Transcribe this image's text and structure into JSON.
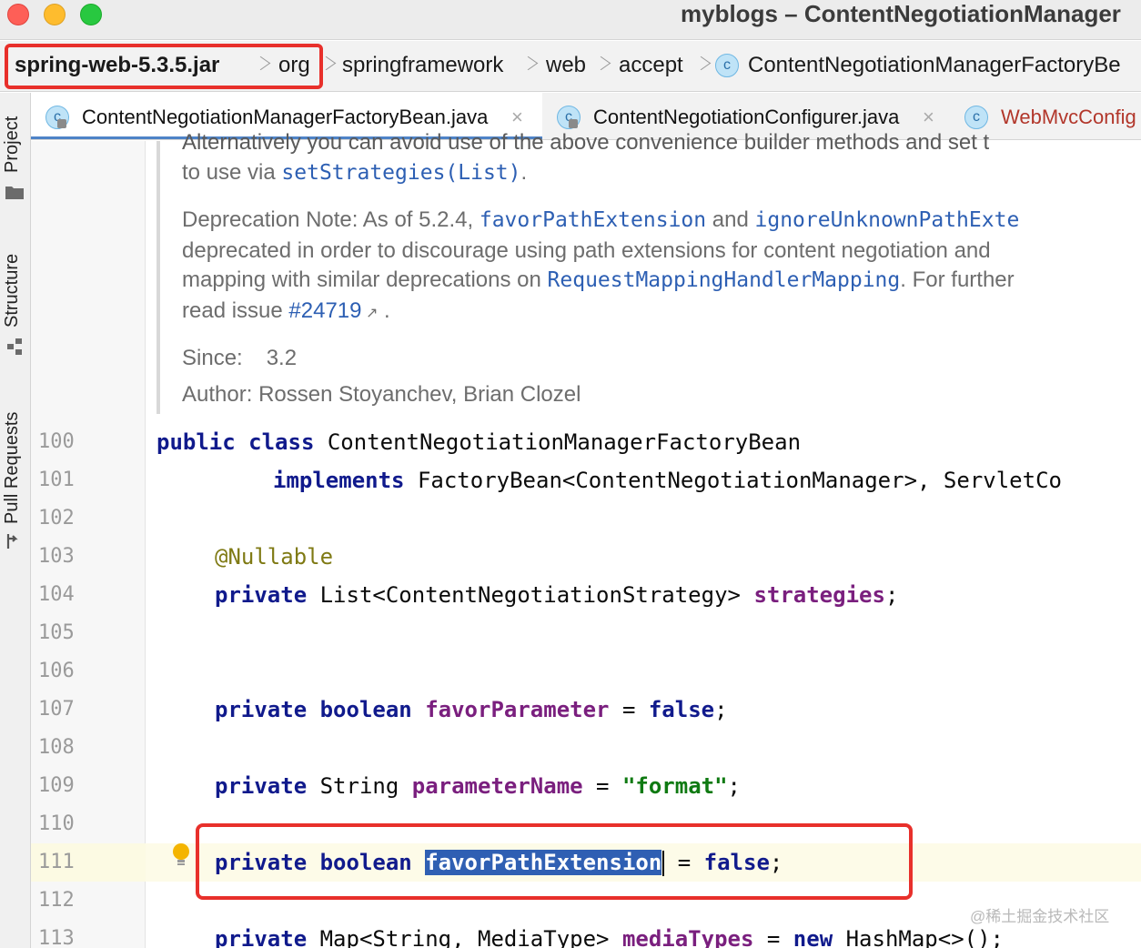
{
  "window": {
    "title": "myblogs – ContentNegotiationManager"
  },
  "breadcrumb": {
    "items": [
      "spring-web-5.3.5.jar",
      "org",
      "springframework",
      "web",
      "accept",
      "ContentNegotiationManagerFactoryBe"
    ]
  },
  "toolstrip": {
    "project": "Project",
    "structure": "Structure",
    "pull_requests": "Pull Requests"
  },
  "tabs": [
    {
      "label": "ContentNegotiationManagerFactoryBean.java",
      "close": "×",
      "active": true
    },
    {
      "label": "ContentNegotiationConfigurer.java",
      "close": "×",
      "active": false
    },
    {
      "label": "WebMvcConfig",
      "active": false
    }
  ],
  "doc": {
    "clipped_line": "Alternatively you can avoid use of the above convenience builder methods and set t",
    "line1_prefix": "to use via ",
    "line1_code": "setStrategies(List)",
    "line1_suffix": ".",
    "note_prefix": "Deprecation Note: As of 5.2.4, ",
    "note_code1": "favorPathExtension",
    "note_and": " and ",
    "note_code2": "ignoreUnknownPathExte",
    "note_line2": "deprecated in order to discourage using path extensions for content negotiation and",
    "note_line3_prefix": "mapping with similar deprecations on ",
    "note_line3_code": "RequestMappingHandlerMapping",
    "note_line3_suffix": ". For further",
    "note_line4_prefix": "read issue ",
    "note_line4_link": "#24719",
    "note_line4_suffix": " .",
    "since_label": "Since:",
    "since_value": "3.2",
    "author_label": "Author:",
    "author_value": "Rossen Stoyanchev, Brian Clozel"
  },
  "code": {
    "line_numbers": [
      "100",
      "101",
      "102",
      "103",
      "104",
      "105",
      "106",
      "107",
      "108",
      "109",
      "110",
      "111",
      "112",
      "113"
    ],
    "l100_kw": "public class",
    "l100_rest": " ContentNegotiationManagerFactoryBean",
    "l101_kw": "implements",
    "l101_rest": " FactoryBean<ContentNegotiationManager>, ServletCo",
    "l103_ann": "@Nullable",
    "l104_kw": "private",
    "l104_type": " List<ContentNegotiationStrategy> ",
    "l104_field": "strategies",
    "l104_end": ";",
    "l107_kw": "private boolean",
    "l107_field": "favorParameter",
    "l107_eq": " = ",
    "l107_val": "false",
    "l107_end": ";",
    "l109_kw": "private",
    "l109_type": " String ",
    "l109_field": "parameterName",
    "l109_eq": " = ",
    "l109_str": "\"format\"",
    "l109_end": ";",
    "l111_kw": "private boolean",
    "l111_field": "favorPathExtension",
    "l111_eq": " = ",
    "l111_val": "false",
    "l111_end": ";",
    "l113_kw": "private",
    "l113_type": " Map<String, MediaType> ",
    "l113_field": "mediaTypes",
    "l113_eq": " = ",
    "l113_new": "new",
    "l113_rest": " HashMap<>();"
  },
  "watermark": "@稀土掘金技术社区",
  "colors": {
    "highlight_box": "#e8302b",
    "keyword": "#101a8c",
    "field": "#7a1f7e",
    "string": "#0f7a12",
    "selection": "#2f5fb3"
  }
}
